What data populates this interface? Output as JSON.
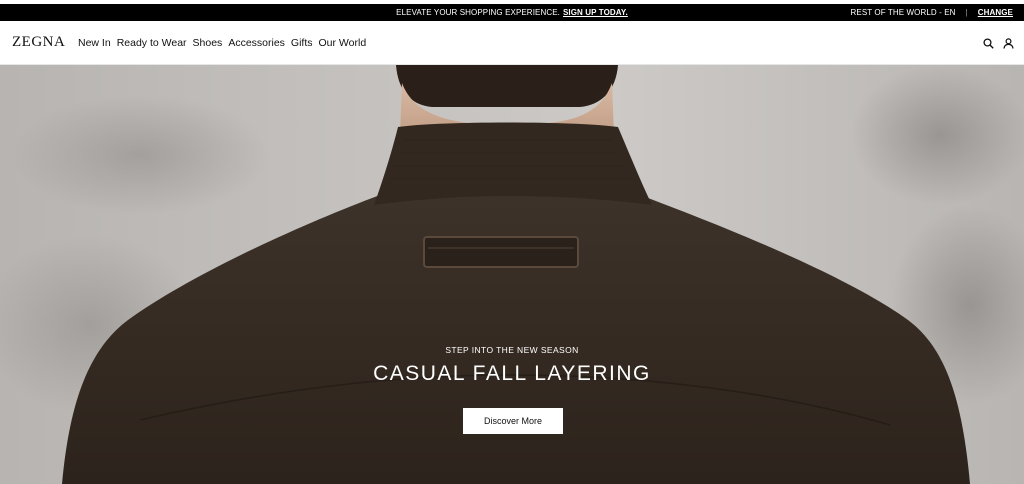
{
  "promo_bar": {
    "message": "ELEVATE YOUR SHOPPING EXPERIENCE.",
    "link": "SIGN UP TODAY.",
    "region": "REST OF THE WORLD - EN",
    "divider": "|",
    "change": "CHANGE"
  },
  "header": {
    "logo": "ZEGNA",
    "nav": [
      {
        "label": "New In"
      },
      {
        "label": "Ready to Wear"
      },
      {
        "label": "Shoes"
      },
      {
        "label": "Accessories"
      },
      {
        "label": "Gifts"
      },
      {
        "label": "Our World"
      }
    ],
    "icons": [
      "search-icon",
      "account-icon"
    ]
  },
  "hero": {
    "eyebrow": "STEP INTO THE NEW SEASON",
    "title": "CASUAL FALL LAYERING",
    "cta": "Discover More"
  },
  "colors": {
    "promo_bg": "#000000",
    "jacket": "#3a2f26",
    "hero_bg": "#c2bfbc"
  }
}
